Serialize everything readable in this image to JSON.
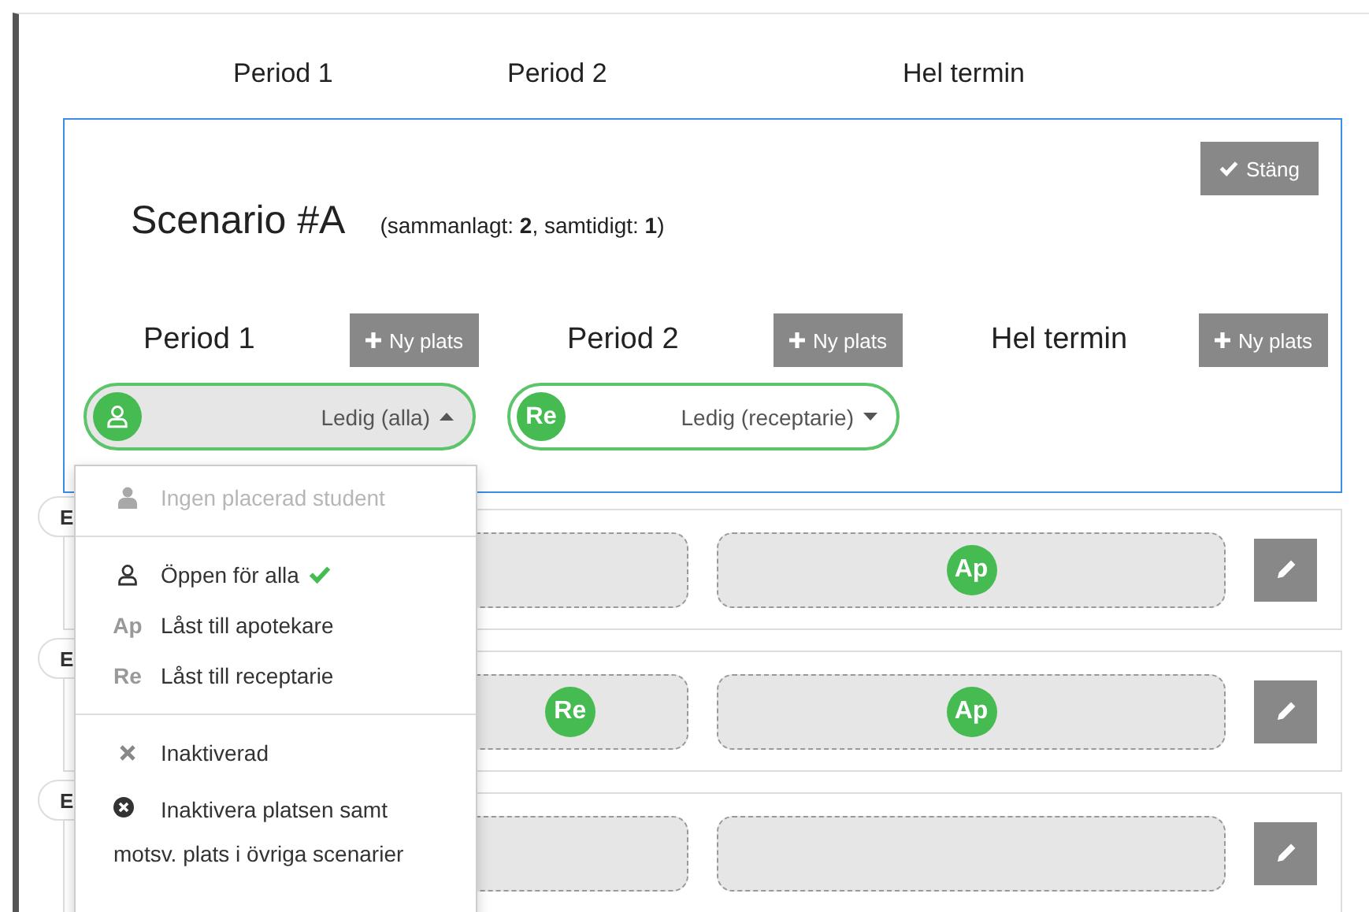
{
  "header_periods": [
    "Period 1",
    "Period 2",
    "Hel termin"
  ],
  "scenario": {
    "title": "Scenario #A",
    "summary": "(sammanlagt: **2**, samtidigt: **1**)",
    "close_button": "Stäng",
    "periods": [
      {
        "label": "Period 1",
        "add_button": "Ny plats",
        "slot": {
          "kind": "open",
          "status": "Ledig (alla)",
          "expanded": true
        }
      },
      {
        "label": "Period 2",
        "add_button": "Ny plats",
        "slot": {
          "kind": "badge",
          "badge": "Re",
          "status": "Ledig (receptarie)",
          "expanded": false
        }
      },
      {
        "label": "Hel termin",
        "add_button": "Ny plats"
      }
    ]
  },
  "dropdown": [
    {
      "kind": "student",
      "label": "Ingen placerad student",
      "disabled": true,
      "checked": false
    },
    {
      "kind": "divider"
    },
    {
      "kind": "open",
      "label": "Öppen för alla",
      "disabled": false,
      "checked": true
    },
    {
      "kind": "role",
      "prefix": "Ap",
      "label": "Låst till apotekare",
      "disabled": false,
      "checked": false
    },
    {
      "kind": "role",
      "prefix": "Re",
      "label": "Låst till receptarie",
      "disabled": false,
      "checked": false
    },
    {
      "kind": "divider"
    },
    {
      "kind": "inactive",
      "label": "Inaktiverad",
      "disabled": false,
      "checked": false
    },
    {
      "kind": "inactive-all",
      "label": "Inaktivera platsen samt motsv. plats i övriga scenarier",
      "disabled": false,
      "checked": false
    }
  ],
  "rows": [
    {
      "tag": "E",
      "slots": [
        {
          "kind": "empty"
        },
        {
          "kind": "badge",
          "badge": "Ap"
        }
      ]
    },
    {
      "tag": "E",
      "slots": [
        {
          "kind": "badge",
          "badge": "Re"
        },
        {
          "kind": "badge",
          "badge": "Ap"
        }
      ]
    },
    {
      "tag": "E",
      "slots": [
        {
          "kind": "empty"
        },
        {
          "kind": "empty"
        }
      ]
    }
  ]
}
